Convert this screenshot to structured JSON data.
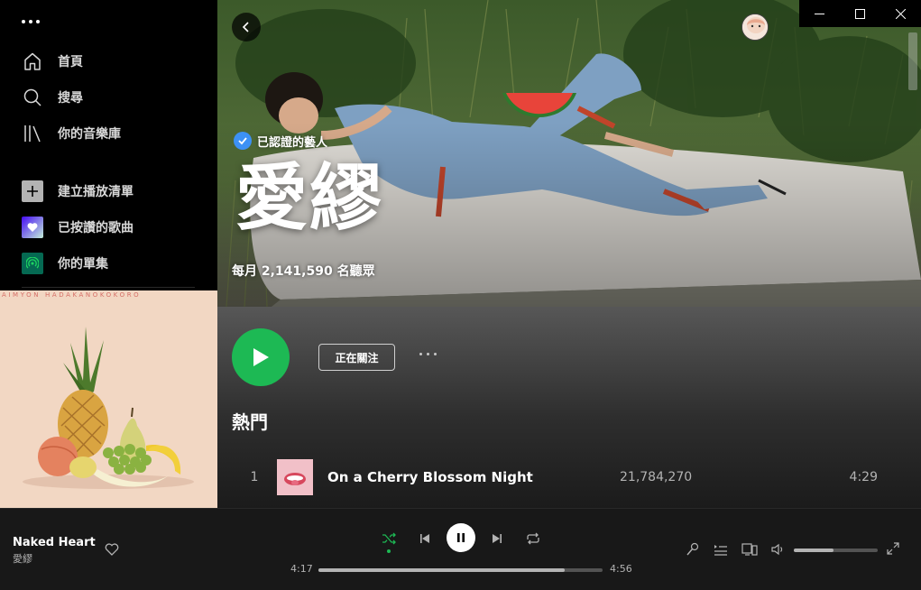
{
  "sidebar": {
    "nav": [
      {
        "label": "首頁",
        "icon": "home-icon"
      },
      {
        "label": "搜尋",
        "icon": "search-icon"
      },
      {
        "label": "你的音樂庫",
        "icon": "library-icon"
      }
    ],
    "actions": [
      {
        "label": "建立播放清單",
        "icon": "plus-icon"
      },
      {
        "label": "已按讚的歌曲",
        "icon": "heart-icon"
      },
      {
        "label": "你的單集",
        "icon": "podcast-icon"
      }
    ],
    "album_strip_text": "AIMYON HADAKANOKOKORO"
  },
  "artist": {
    "verified_label": "已認證的藝人",
    "name": "愛繆",
    "monthly_listeners": "每月 2,141,590 名聽眾",
    "follow_label": "正在關注",
    "popular_heading": "熱門"
  },
  "tracks": [
    {
      "number": "1",
      "title": "On a Cherry Blossom Night",
      "plays": "21,784,270",
      "duration": "4:29"
    }
  ],
  "player": {
    "title": "Naked Heart",
    "artist": "愛繆",
    "elapsed": "4:17",
    "total": "4:56",
    "progress_fraction": 0.868,
    "volume_fraction": 0.47,
    "shuffle_active": true
  },
  "colors": {
    "accent": "#1db954",
    "verified": "#3d91f4",
    "background": "#121212"
  }
}
